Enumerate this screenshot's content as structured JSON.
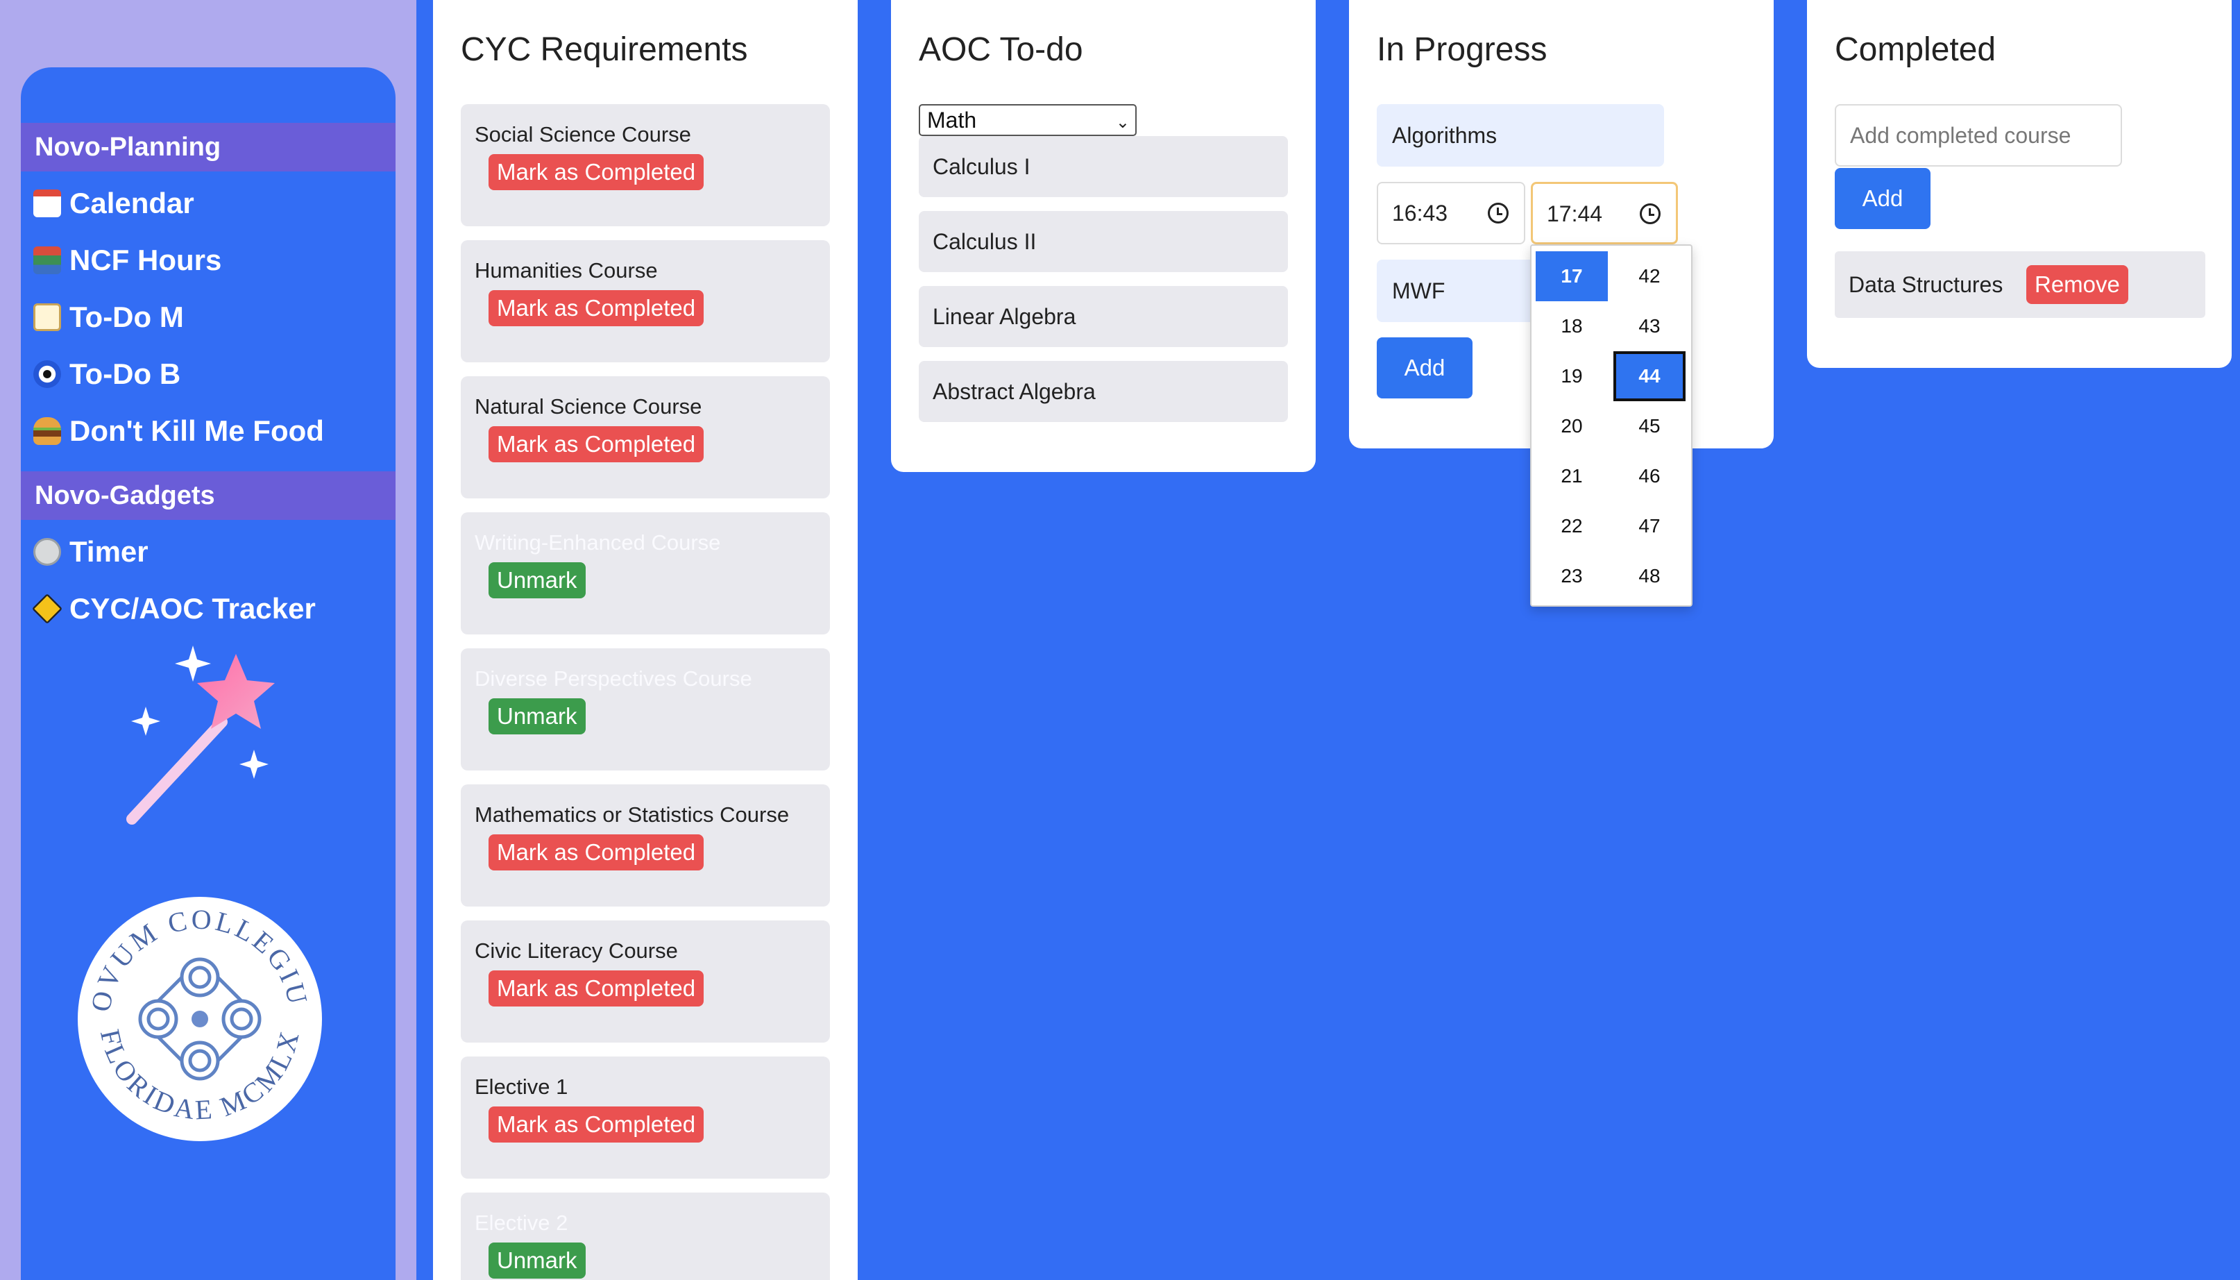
{
  "sidebar": {
    "sections": [
      "Novo-Planning",
      "Novo-Gadgets"
    ],
    "items": [
      {
        "label": "Calendar",
        "icon": "calendar-icon"
      },
      {
        "label": "NCF Hours",
        "icon": "books-icon"
      },
      {
        "label": "To-Do M",
        "icon": "memo-icon"
      },
      {
        "label": "To-Do B",
        "icon": "nazar-eye-icon"
      },
      {
        "label": "Don't Kill Me Food",
        "icon": "burger-icon"
      },
      {
        "label": "Timer",
        "icon": "timer-icon"
      },
      {
        "label": "CYC/AOC Tracker",
        "icon": "warning-sign-icon"
      }
    ],
    "seal_text": "NOVUM COLLEGIUM FLORIDAE MCMLX"
  },
  "cyc": {
    "title": "CYC Requirements",
    "mark_label": "Mark as Completed",
    "unmark_label": "Unmark",
    "requirements": [
      {
        "label": "Social Science Course",
        "completed": false
      },
      {
        "label": "Humanities Course",
        "completed": false
      },
      {
        "label": "Natural Science Course",
        "completed": false
      },
      {
        "label": "Writing-Enhanced Course",
        "completed": true
      },
      {
        "label": "Diverse Perspectives Course",
        "completed": true
      },
      {
        "label": "Mathematics or Statistics Course",
        "completed": false
      },
      {
        "label": "Civic Literacy Course",
        "completed": false
      },
      {
        "label": "Elective 1",
        "completed": false
      },
      {
        "label": "Elective 2",
        "completed": true
      }
    ]
  },
  "aoc": {
    "title": "AOC To-do",
    "selected": "Math",
    "courses": [
      "Calculus I",
      "Calculus II",
      "Linear Algebra",
      "Abstract Algebra"
    ]
  },
  "progress": {
    "title": "In Progress",
    "course_value": "Algorithms",
    "start_time": "16:43",
    "end_time": "17:44",
    "days_value": "MWF",
    "add_label": "Add",
    "picker": {
      "hours": [
        "17",
        "18",
        "19",
        "20",
        "21",
        "22",
        "23"
      ],
      "minutes": [
        "42",
        "43",
        "44",
        "45",
        "46",
        "47",
        "48"
      ],
      "selected_hour": "17",
      "selected_minute": "44"
    }
  },
  "completed": {
    "title": "Completed",
    "placeholder": "Add completed course",
    "add_label": "Add",
    "remove_label": "Remove",
    "courses": [
      "Data Structures"
    ]
  },
  "colors": {
    "background": "#336df4",
    "section_header": "#6a5dd8",
    "mark_red": "#ea5151",
    "unmark_green": "#3c9c4c",
    "primary_blue": "#2f74f0"
  }
}
